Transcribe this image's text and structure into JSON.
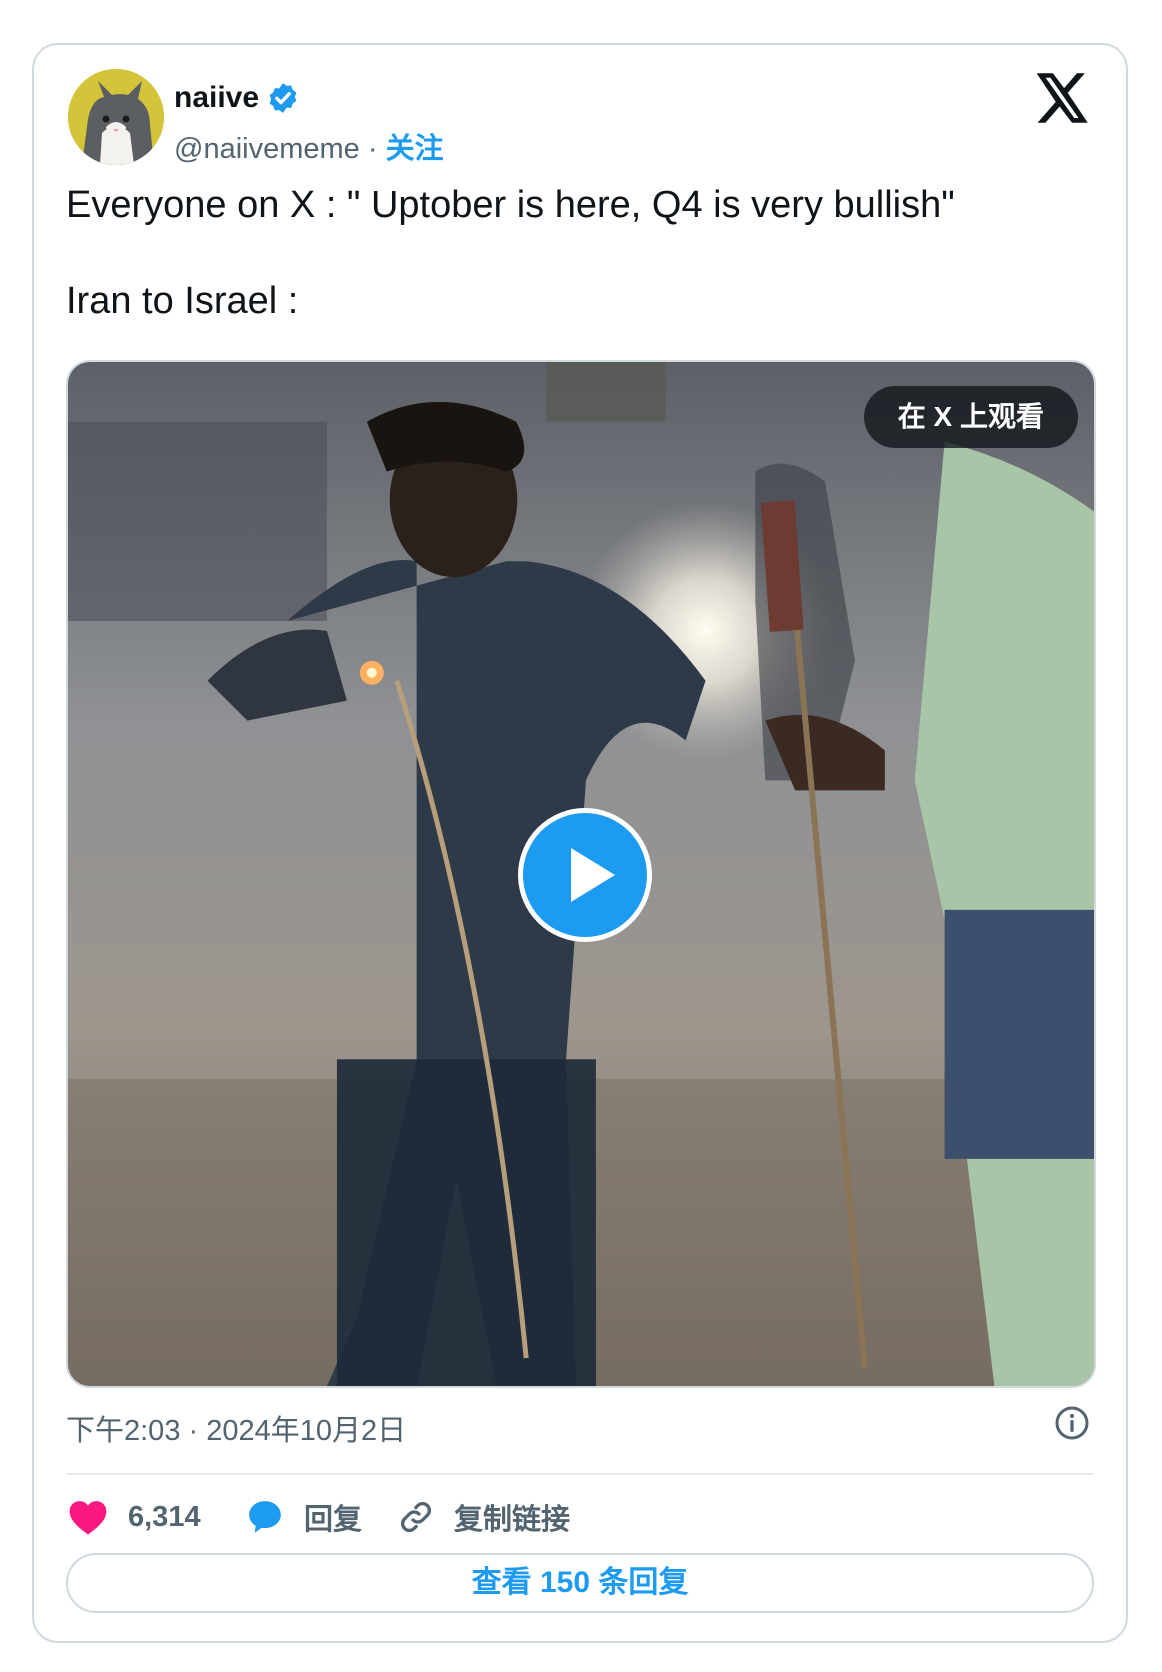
{
  "author": {
    "name": "naiive",
    "handle": "@naiivememe",
    "separator": "·",
    "follow_label": "关注"
  },
  "post": {
    "lines": [
      "Everyone on X : \" Uptober is here, Q4 is very bullish\"",
      "Iran to Israel :"
    ]
  },
  "media": {
    "watch_on_x_label": "在 X 上观看"
  },
  "meta": {
    "timestamp": "下午2:03 · 2024年10月2日"
  },
  "actions": {
    "likes_count": "6,314",
    "reply_label": "回复",
    "copy_link_label": "复制链接"
  },
  "view_replies_label": "查看 150 条回复",
  "colors": {
    "accent": "#1d9bf0",
    "like": "#f91880",
    "muted": "#536471"
  }
}
